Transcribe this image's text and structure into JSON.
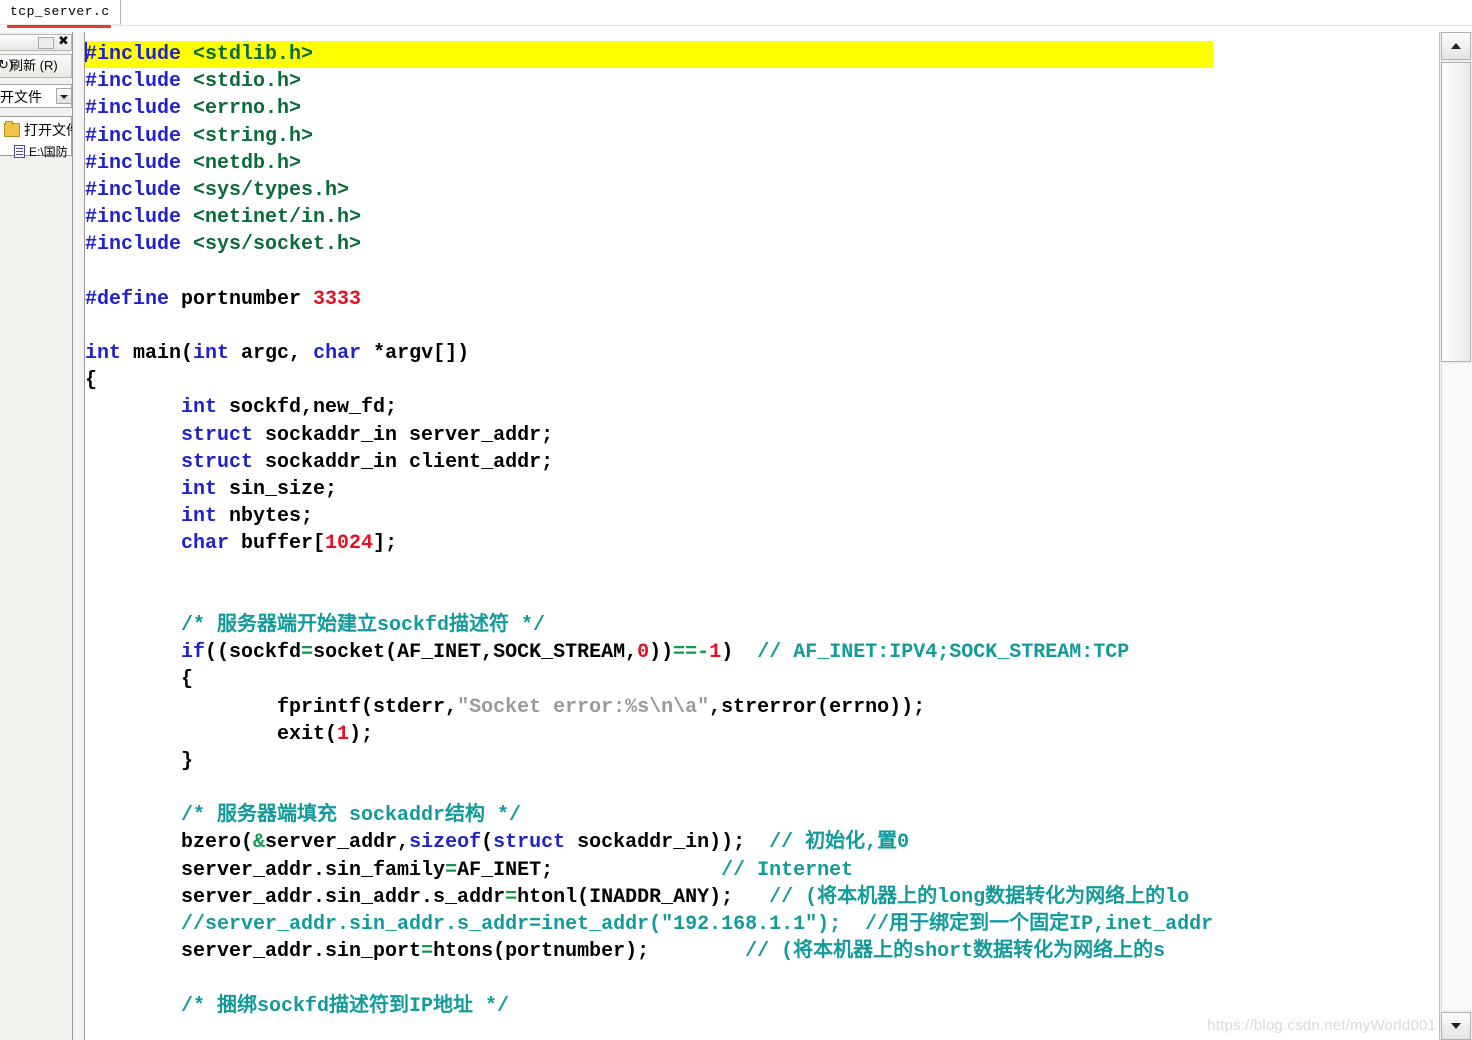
{
  "tab": {
    "label": "tcp_server.c",
    "underline_color": "#e8392c"
  },
  "left_panel": {
    "close_label": "✖",
    "refresh_label": "刷新 (R)",
    "refresh_prefix": "↻)",
    "combo_value": "开文件",
    "tree": [
      {
        "label": "打开文件",
        "icon": "folder-icon"
      },
      {
        "label": "E:\\国防",
        "icon": "document-icon"
      }
    ]
  },
  "editor": {
    "highlight_color": "#ffff00",
    "colors": {
      "keyword": "#2222cc",
      "header": "#0b6b3a",
      "number": "#e81123",
      "string": "#9a9a9a",
      "comment": "#139a9a",
      "operator": "#0f9b4c",
      "plain": "#000000"
    },
    "lines": [
      {
        "n": 1,
        "highlight": true,
        "caret": true,
        "tokens": [
          {
            "t": "#include",
            "c": "kw"
          },
          {
            "t": " ",
            "c": "pln"
          },
          {
            "t": "<stdlib.h>",
            "c": "hdr"
          }
        ]
      },
      {
        "n": 2,
        "tokens": [
          {
            "t": "#include",
            "c": "kw"
          },
          {
            "t": " ",
            "c": "pln"
          },
          {
            "t": "<stdio.h>",
            "c": "hdr"
          }
        ]
      },
      {
        "n": 3,
        "tokens": [
          {
            "t": "#include",
            "c": "kw"
          },
          {
            "t": " ",
            "c": "pln"
          },
          {
            "t": "<errno.h>",
            "c": "hdr"
          }
        ]
      },
      {
        "n": 4,
        "tokens": [
          {
            "t": "#include",
            "c": "kw"
          },
          {
            "t": " ",
            "c": "pln"
          },
          {
            "t": "<string.h>",
            "c": "hdr"
          }
        ]
      },
      {
        "n": 5,
        "tokens": [
          {
            "t": "#include",
            "c": "kw"
          },
          {
            "t": " ",
            "c": "pln"
          },
          {
            "t": "<netdb.h>",
            "c": "hdr"
          }
        ]
      },
      {
        "n": 6,
        "tokens": [
          {
            "t": "#include",
            "c": "kw"
          },
          {
            "t": " ",
            "c": "pln"
          },
          {
            "t": "<sys/types.h>",
            "c": "hdr"
          }
        ]
      },
      {
        "n": 7,
        "tokens": [
          {
            "t": "#include",
            "c": "kw"
          },
          {
            "t": " ",
            "c": "pln"
          },
          {
            "t": "<netinet/in.h>",
            "c": "hdr"
          }
        ]
      },
      {
        "n": 8,
        "tokens": [
          {
            "t": "#include",
            "c": "kw"
          },
          {
            "t": " ",
            "c": "pln"
          },
          {
            "t": "<sys/socket.h>",
            "c": "hdr"
          }
        ]
      },
      {
        "n": 9,
        "tokens": []
      },
      {
        "n": 10,
        "tokens": [
          {
            "t": "#define",
            "c": "kw"
          },
          {
            "t": " portnumber ",
            "c": "pln"
          },
          {
            "t": "3333",
            "c": "num"
          }
        ]
      },
      {
        "n": 11,
        "tokens": []
      },
      {
        "n": 12,
        "tokens": [
          {
            "t": "int",
            "c": "kw"
          },
          {
            "t": " main(",
            "c": "pln"
          },
          {
            "t": "int",
            "c": "kw"
          },
          {
            "t": " argc, ",
            "c": "pln"
          },
          {
            "t": "char",
            "c": "kw"
          },
          {
            "t": " *argv[])",
            "c": "pln"
          }
        ]
      },
      {
        "n": 13,
        "tokens": [
          {
            "t": "{",
            "c": "pln"
          }
        ]
      },
      {
        "n": 14,
        "tokens": [
          {
            "t": "        ",
            "c": "pln"
          },
          {
            "t": "int",
            "c": "kw"
          },
          {
            "t": " sockfd,new_fd;",
            "c": "pln"
          }
        ]
      },
      {
        "n": 15,
        "tokens": [
          {
            "t": "        ",
            "c": "pln"
          },
          {
            "t": "struct",
            "c": "kw"
          },
          {
            "t": " sockaddr_in server_addr;",
            "c": "pln"
          }
        ]
      },
      {
        "n": 16,
        "tokens": [
          {
            "t": "        ",
            "c": "pln"
          },
          {
            "t": "struct",
            "c": "kw"
          },
          {
            "t": " sockaddr_in client_addr;",
            "c": "pln"
          }
        ]
      },
      {
        "n": 17,
        "tokens": [
          {
            "t": "        ",
            "c": "pln"
          },
          {
            "t": "int",
            "c": "kw"
          },
          {
            "t": " sin_size;",
            "c": "pln"
          }
        ]
      },
      {
        "n": 18,
        "tokens": [
          {
            "t": "        ",
            "c": "pln"
          },
          {
            "t": "int",
            "c": "kw"
          },
          {
            "t": " nbytes;",
            "c": "pln"
          }
        ]
      },
      {
        "n": 19,
        "tokens": [
          {
            "t": "        ",
            "c": "pln"
          },
          {
            "t": "char",
            "c": "kw"
          },
          {
            "t": " buffer[",
            "c": "pln"
          },
          {
            "t": "1024",
            "c": "num"
          },
          {
            "t": "];",
            "c": "pln"
          }
        ]
      },
      {
        "n": 20,
        "tokens": []
      },
      {
        "n": 21,
        "tokens": []
      },
      {
        "n": 22,
        "tokens": [
          {
            "t": "        ",
            "c": "pln"
          },
          {
            "t": "/* 服务器端开始建立sockfd描述符 */",
            "c": "cmt"
          }
        ]
      },
      {
        "n": 23,
        "tokens": [
          {
            "t": "        ",
            "c": "pln"
          },
          {
            "t": "if",
            "c": "kw"
          },
          {
            "t": "((sockfd",
            "c": "pln"
          },
          {
            "t": "=",
            "c": "op"
          },
          {
            "t": "socket(AF_INET,SOCK_STREAM,",
            "c": "pln"
          },
          {
            "t": "0",
            "c": "num"
          },
          {
            "t": "))",
            "c": "pln"
          },
          {
            "t": "==",
            "c": "op"
          },
          {
            "t": "-",
            "c": "op"
          },
          {
            "t": "1",
            "c": "num"
          },
          {
            "t": ")  ",
            "c": "pln"
          },
          {
            "t": "// AF_INET:IPV4;SOCK_STREAM:TCP",
            "c": "cmt"
          }
        ]
      },
      {
        "n": 24,
        "tokens": [
          {
            "t": "        {",
            "c": "pln"
          }
        ]
      },
      {
        "n": 25,
        "tokens": [
          {
            "t": "                fprintf(stderr,",
            "c": "pln"
          },
          {
            "t": "\"Socket error:%s\\n\\a\"",
            "c": "str"
          },
          {
            "t": ",strerror(errno));",
            "c": "pln"
          }
        ]
      },
      {
        "n": 26,
        "tokens": [
          {
            "t": "                exit(",
            "c": "pln"
          },
          {
            "t": "1",
            "c": "num"
          },
          {
            "t": ");",
            "c": "pln"
          }
        ]
      },
      {
        "n": 27,
        "tokens": [
          {
            "t": "        }",
            "c": "pln"
          }
        ]
      },
      {
        "n": 28,
        "tokens": []
      },
      {
        "n": 29,
        "tokens": [
          {
            "t": "        ",
            "c": "pln"
          },
          {
            "t": "/* 服务器端填充 sockaddr结构 */",
            "c": "cmt"
          }
        ]
      },
      {
        "n": 30,
        "tokens": [
          {
            "t": "        bzero(",
            "c": "pln"
          },
          {
            "t": "&",
            "c": "op"
          },
          {
            "t": "server_addr,",
            "c": "pln"
          },
          {
            "t": "sizeof",
            "c": "kw"
          },
          {
            "t": "(",
            "c": "pln"
          },
          {
            "t": "struct",
            "c": "kw"
          },
          {
            "t": " sockaddr_in));  ",
            "c": "pln"
          },
          {
            "t": "// 初始化,置0",
            "c": "cmt"
          }
        ]
      },
      {
        "n": 31,
        "tokens": [
          {
            "t": "        server_addr.sin_family",
            "c": "pln"
          },
          {
            "t": "=",
            "c": "op"
          },
          {
            "t": "AF_INET;              ",
            "c": "pln"
          },
          {
            "t": "// Internet",
            "c": "cmt"
          }
        ]
      },
      {
        "n": 32,
        "tokens": [
          {
            "t": "        server_addr.sin_addr.s_addr",
            "c": "pln"
          },
          {
            "t": "=",
            "c": "op"
          },
          {
            "t": "htonl(INADDR_ANY);   ",
            "c": "pln"
          },
          {
            "t": "// (将本机器上的long数据转化为网络上的lo",
            "c": "cmt"
          }
        ]
      },
      {
        "n": 33,
        "tokens": [
          {
            "t": "        //server_addr.sin_addr.s_addr=inet_addr(\"192.168.1.1\");  //用于绑定到一个固定IP,inet_addr",
            "c": "cmt"
          }
        ]
      },
      {
        "n": 34,
        "tokens": [
          {
            "t": "        server_addr.sin_port",
            "c": "pln"
          },
          {
            "t": "=",
            "c": "op"
          },
          {
            "t": "htons(portnumber);        ",
            "c": "pln"
          },
          {
            "t": "// (将本机器上的short数据转化为网络上的s",
            "c": "cmt"
          }
        ]
      },
      {
        "n": 35,
        "tokens": []
      },
      {
        "n": 36,
        "tokens": [
          {
            "t": "        ",
            "c": "pln"
          },
          {
            "t": "/* 捆绑sockfd描述符到IP地址 */",
            "c": "cmt"
          }
        ]
      }
    ]
  },
  "scrollbar": {
    "up_arrow": "▲",
    "down_arrow": "▼"
  },
  "watermark": {
    "text": "https://blog.csdn.net/myWorld001"
  }
}
